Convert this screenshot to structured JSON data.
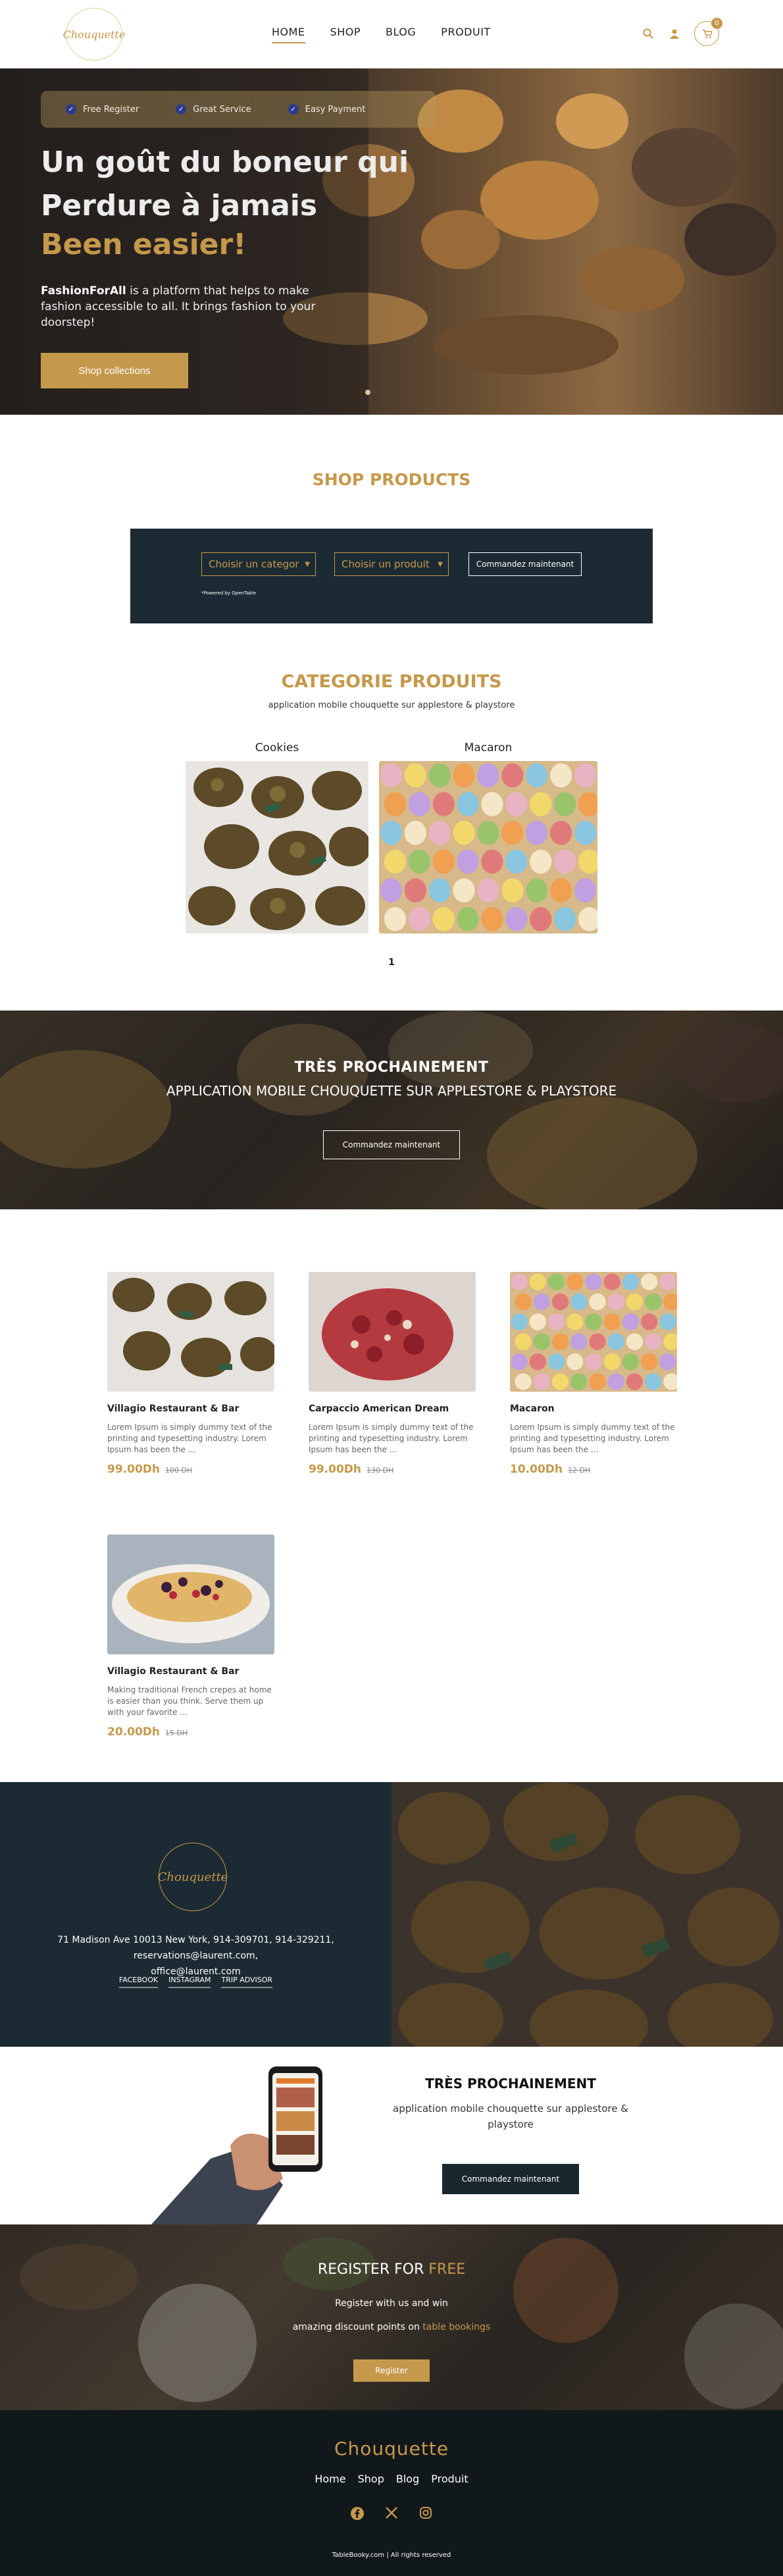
{
  "header": {
    "logo_text": "Chouquette",
    "nav": [
      "HOME",
      "SHOP",
      "BLOG",
      "PRODUIT"
    ],
    "cart_count": "0",
    "icons": [
      "search-icon",
      "user-icon",
      "cart-icon"
    ]
  },
  "hero": {
    "features": [
      "Free Register",
      "Great Service",
      "Easy Payment"
    ],
    "title": "Un goût du boneur qui Perdure à jamais",
    "subtitle": "Been easier!",
    "desc_brand": "FashionForAll",
    "desc_rest": " is a platform that helps to make fashion accessible to all. It brings fashion to your doorstep!",
    "button": "Shop collections"
  },
  "shop": {
    "title": "SHOP PRODUCTS",
    "select_category": "Choisir un categor",
    "select_product": "Choisir un produit",
    "button": "Commandez maintenant",
    "powered": "*Powered by OpenTable"
  },
  "categories": {
    "title": "CATEGORIE PRODUITS",
    "subtitle": "application mobile chouquette sur applestore & playstore",
    "items": [
      {
        "label": "Cookies"
      },
      {
        "label": "Macaron"
      }
    ],
    "page": "1"
  },
  "soon": {
    "title": "TRÈS PROCHAINEMENT",
    "text": "APPLICATION MOBILE CHOUQUETTE SUR APPLESTORE & PLAYSTORE",
    "button": "Commandez maintenant"
  },
  "products": [
    {
      "name": "Villagio Restaurant & Bar",
      "desc": "Lorem Ipsum is simply dummy text of the printing and typesetting industry. Lorem Ipsum has been the ...",
      "price": "99.00Dh",
      "old": "100 DH"
    },
    {
      "name": "Carpaccio American Dream",
      "desc": "Lorem Ipsum is simply dummy text of the printing and typesetting industry. Lorem Ipsum has been the ...",
      "price": "99.00Dh",
      "old": "130 DH"
    },
    {
      "name": "Macaron",
      "desc": "Lorem Ipsum is simply dummy text of the printing and typesetting industry. Lorem Ipsum has been the ...",
      "price": "10.00Dh",
      "old": "12 DH"
    },
    {
      "name": "Villagio Restaurant & Bar",
      "desc": "Making traditional French crepes at home is easier than you think. Serve them up with your favorite ...",
      "price": "20.00Dh",
      "old": "15 DH"
    }
  ],
  "contact": {
    "logo_text": "Chouquette",
    "address_line1": "71 Madison Ave 10013 New York, 914-309701, 914-329211, reservations@laurent.com,",
    "address_line2": "office@laurent.com",
    "links": [
      "FACEBOOK",
      "INSTAGRAM",
      "TRIP ADVISOR"
    ]
  },
  "app": {
    "title": "TRÈS PROCHAINEMENT",
    "text": "application mobile chouquette sur applestore & playstore",
    "button": "Commandez maintenant"
  },
  "register": {
    "title_a": "REGISTER FOR ",
    "title_b": "FREE",
    "line1": "Register with us and win",
    "line2_a": "amazing discount points on ",
    "line2_b": "table bookings",
    "button": "Register"
  },
  "footer": {
    "brand": "Chouquette",
    "nav": [
      "Home",
      "Shop",
      "Blog",
      "Produit"
    ],
    "social": [
      "facebook-icon",
      "x-icon",
      "instagram-icon"
    ],
    "copyright": "TableBooky.com | All rights reserved"
  },
  "colors": {
    "accent": "#c5994b",
    "dark": "#1c2a33",
    "footer": "#11181c"
  }
}
